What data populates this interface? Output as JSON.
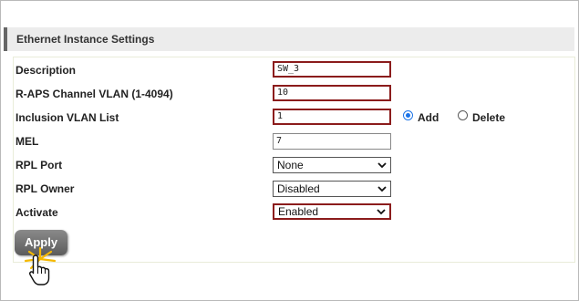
{
  "section": {
    "title": "Ethernet Instance Settings"
  },
  "form": {
    "description": {
      "label": "Description",
      "value": "SW_3"
    },
    "raps_vlan": {
      "label": "R-APS Channel VLAN (1-4094)",
      "value": "10"
    },
    "inclusion_vlan": {
      "label": "Inclusion VLAN List",
      "value": "1"
    },
    "mel": {
      "label": "MEL",
      "value": "7"
    },
    "rpl_port": {
      "label": "RPL Port",
      "selected": "None"
    },
    "rpl_owner": {
      "label": "RPL Owner",
      "selected": "Disabled"
    },
    "activate": {
      "label": "Activate",
      "selected": "Enabled"
    },
    "vlan_action": {
      "add_label": "Add",
      "delete_label": "Delete",
      "selected": "Add"
    }
  },
  "buttons": {
    "apply_label": "Apply"
  },
  "colors": {
    "highlight_border": "#8b1c1c",
    "radio_accent": "#1a73e8",
    "button_bg": "#6e6e6e"
  },
  "icons": {
    "cursor": "hand-pointer-icon",
    "click_burst": "click-burst-icon",
    "dropdown": "chevron-down-icon"
  }
}
